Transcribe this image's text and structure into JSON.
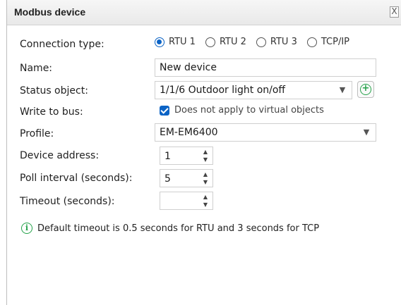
{
  "dialog": {
    "title": "Modbus device",
    "close_label": "X"
  },
  "form": {
    "connection_type_label": "Connection type:",
    "connection_options": [
      "RTU 1",
      "RTU 2",
      "RTU 3",
      "TCP/IP"
    ],
    "connection_selected": "RTU 1",
    "name_label": "Name:",
    "name_value": "New device",
    "status_object_label": "Status object:",
    "status_object_value": "1/1/6 Outdoor light on/off",
    "write_to_bus_label": "Write to bus:",
    "write_to_bus_checked": true,
    "write_to_bus_text": "Does not apply to virtual objects",
    "profile_label": "Profile:",
    "profile_value": "EM-EM6400",
    "device_address_label": "Device address:",
    "device_address_value": "1",
    "poll_interval_label": "Poll interval (seconds):",
    "poll_interval_value": "5",
    "timeout_label": "Timeout (seconds):",
    "timeout_value": ""
  },
  "info": {
    "icon": "info-icon",
    "text": "Default timeout is 0.5 seconds for RTU and 3 seconds for TCP"
  },
  "colors": {
    "accent": "#0b63c5",
    "add_green": "#25a24a"
  }
}
